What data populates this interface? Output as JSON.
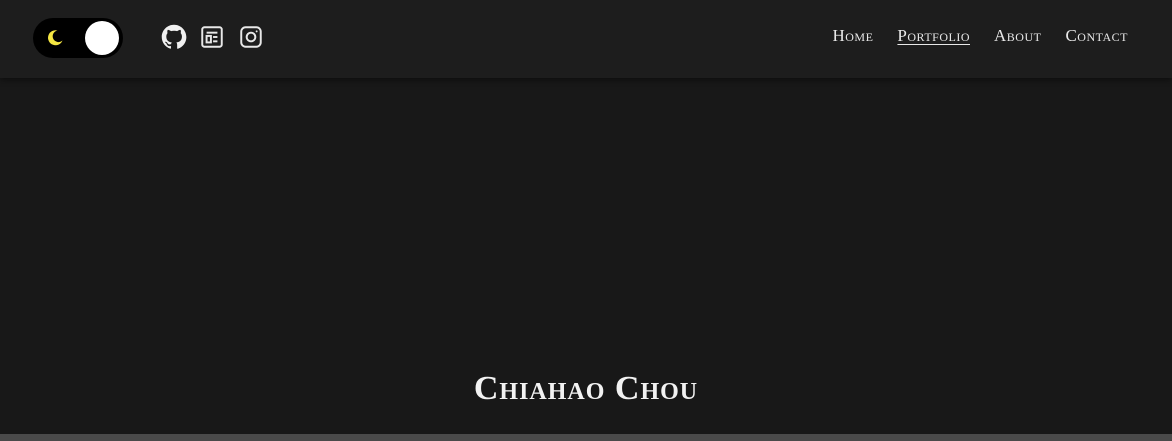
{
  "header": {
    "theme_toggle": {
      "state": "dark",
      "icon": "moon-icon",
      "moon_color": "#f5e642"
    },
    "social_icons": [
      "github-icon",
      "blog-icon",
      "instagram-icon"
    ],
    "nav": [
      {
        "label": "Home",
        "active": false
      },
      {
        "label": "Portfolio",
        "active": true
      },
      {
        "label": "About",
        "active": false
      },
      {
        "label": "Contact",
        "active": false
      }
    ]
  },
  "hero": {
    "name": "Chiahao Chou"
  },
  "colors": {
    "background": "#181818",
    "header_background": "#1d1d1d",
    "text": "#e8e8e8",
    "toggle_track": "#000000",
    "toggle_knob": "#ffffff"
  }
}
